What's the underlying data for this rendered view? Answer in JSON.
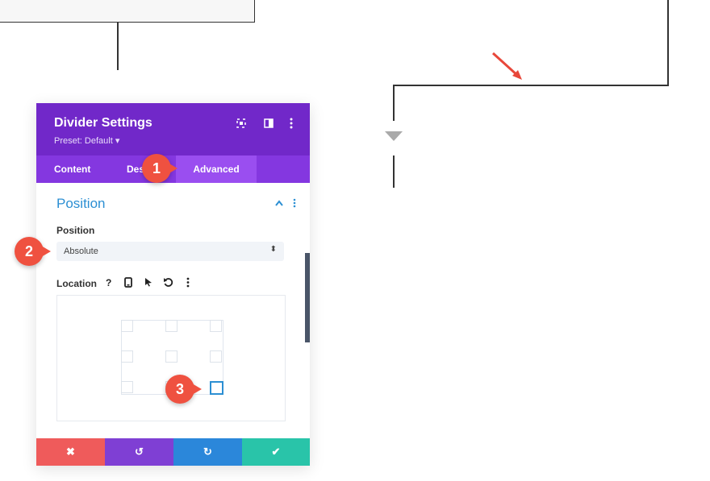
{
  "panel": {
    "title": "Divider Settings",
    "preset": "Preset: Default ▾",
    "header_icons": {
      "expand": "expand-icon",
      "columns": "columns-icon",
      "more": "more-vertical-icon"
    },
    "tabs": [
      {
        "label": "Content"
      },
      {
        "label": "Des"
      },
      {
        "label": "Advanced",
        "active": true
      }
    ],
    "section": {
      "title": "Position",
      "collapse_icon": "chevron-up-icon"
    },
    "position_field": {
      "label": "Position",
      "value": "Absolute"
    },
    "location_field": {
      "label": "Location",
      "icons": [
        "help-icon",
        "mobile-icon",
        "pointer-icon",
        "reset-icon",
        "more-vertical-icon"
      ],
      "help_glyph": "?"
    },
    "footer": {
      "cancel": "✖",
      "undo": "↺",
      "redo": "↻",
      "save": "✔"
    }
  },
  "callouts": [
    "1",
    "2",
    "3"
  ],
  "colors": {
    "header": "#7128c9",
    "tabs": "#8437e0",
    "accent_blue": "#2c8fd3",
    "cancel": "#ef5b5b",
    "undo": "#7f3fd4",
    "redo": "#2b87da",
    "save": "#29c4a9",
    "callout": "#ef5140"
  }
}
